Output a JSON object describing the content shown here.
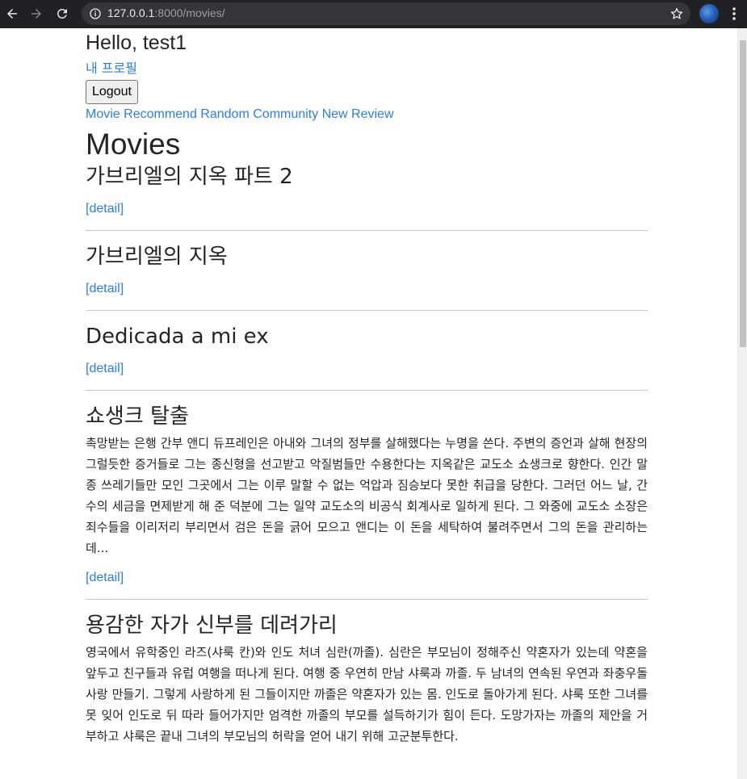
{
  "browser": {
    "url_host": "127.0.0.1",
    "url_rest": ":8000/movies/",
    "icons": [
      "back-arrow-icon",
      "forward-arrow-icon",
      "reload-icon",
      "info-icon",
      "star-icon",
      "profile-avatar-icon",
      "menu-dots-icon"
    ]
  },
  "header": {
    "greeting": "Hello, test1",
    "profile_link": "내 프로필",
    "logout_label": "Logout",
    "nav": [
      "Movie",
      "Recommend",
      "Random",
      "Community",
      "New Review"
    ]
  },
  "page_title": "Movies",
  "movies": [
    {
      "title": "가브리엘의 지옥 파트 2",
      "overview": "",
      "detail": "[detail]"
    },
    {
      "title": "가브리엘의 지옥",
      "overview": "",
      "detail": "[detail]"
    },
    {
      "title": "Dedicada a mi ex",
      "overview": "",
      "detail": "[detail]"
    },
    {
      "title": "쇼생크 탈출",
      "overview": "촉망받는 은행 간부 앤디 듀프레인은 아내와 그녀의 정부를 살해했다는 누명을 쓴다. 주변의 증언과 살해 현장의 그럴듯한 증거들로 그는 종신형을 선고받고 악질범들만 수용한다는 지옥같은 교도소 쇼생크로 향한다. 인간 말종 쓰레기들만 모인 그곳에서 그는 이루 말할 수 없는 억압과 짐승보다 못한 취급을 당한다. 그러던 어느 날, 간수의 세금을 면제받게 해 준 덕분에 그는 일약 교도소의 비공식 회계사로 일하게 된다. 그 와중에 교도소 소장은 죄수들을 이리저리 부리면서 검은 돈을 긁어 모으고 앤디는 이 돈을 세탁하여 불려주면서 그의 돈을 관리하는데...",
      "detail": "[detail]"
    },
    {
      "title": "용감한 자가 신부를 데려가리",
      "overview": "영국에서 유학중인 라즈(샤룩 칸)와 인도 처녀 심란(까졸). 심란은 부모님이 정해주신 약혼자가 있는데 약혼을 앞두고 친구들과 유럽 여행을 떠나게 된다. 여행 중 우연히 만남 샤룩과 까졸. 두 남녀의 연속된 우연과 좌충우돌 사랑 만들기. 그렇게 사랑하게 된 그들이지만 까졸은 약혼자가 있는 몸. 인도로 돌아가게 된다. 샤룩 또한 그녀를 못 잊어 인도로 뒤 따라 들어가지만 엄격한 까졸의 부모를 설득하기가 힘이 든다. 도망가자는 까졸의 제안을 거부하고 샤룩은 끝내 그녀의 부모님의 허락을 얻어 내기 위해 고군분투한다.",
      "detail": ""
    }
  ]
}
